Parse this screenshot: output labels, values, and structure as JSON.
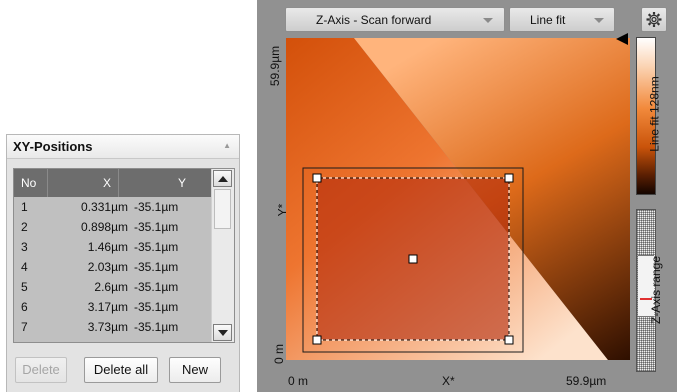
{
  "xy_panel": {
    "title": "XY-Positions",
    "columns": [
      "No",
      "X",
      "Y"
    ],
    "rows": [
      {
        "no": "1",
        "x": "0.331µm",
        "y": "-35.1µm"
      },
      {
        "no": "2",
        "x": "0.898µm",
        "y": "-35.1µm"
      },
      {
        "no": "3",
        "x": "1.46µm",
        "y": "-35.1µm"
      },
      {
        "no": "4",
        "x": "2.03µm",
        "y": "-35.1µm"
      },
      {
        "no": "5",
        "x": "2.6µm",
        "y": "-35.1µm"
      },
      {
        "no": "6",
        "x": "3.17µm",
        "y": "-35.1µm"
      },
      {
        "no": "7",
        "x": "3.73µm",
        "y": "-35.1µm"
      }
    ],
    "buttons": {
      "delete": "Delete",
      "delete_all": "Delete all",
      "new": "New"
    }
  },
  "viewer": {
    "channel_select": "Z-Axis - Scan forward",
    "filter_select": "Line fit",
    "settings_icon": "gear-icon",
    "y_axis": {
      "name": "Y*",
      "top": "59.9µm",
      "bottom": "0 m"
    },
    "x_axis": {
      "name": "X*",
      "left": "0 m",
      "right": "59.9µm"
    },
    "colorbar_label": "Line fit 128nm",
    "range_label": "Z-Axis range"
  }
}
